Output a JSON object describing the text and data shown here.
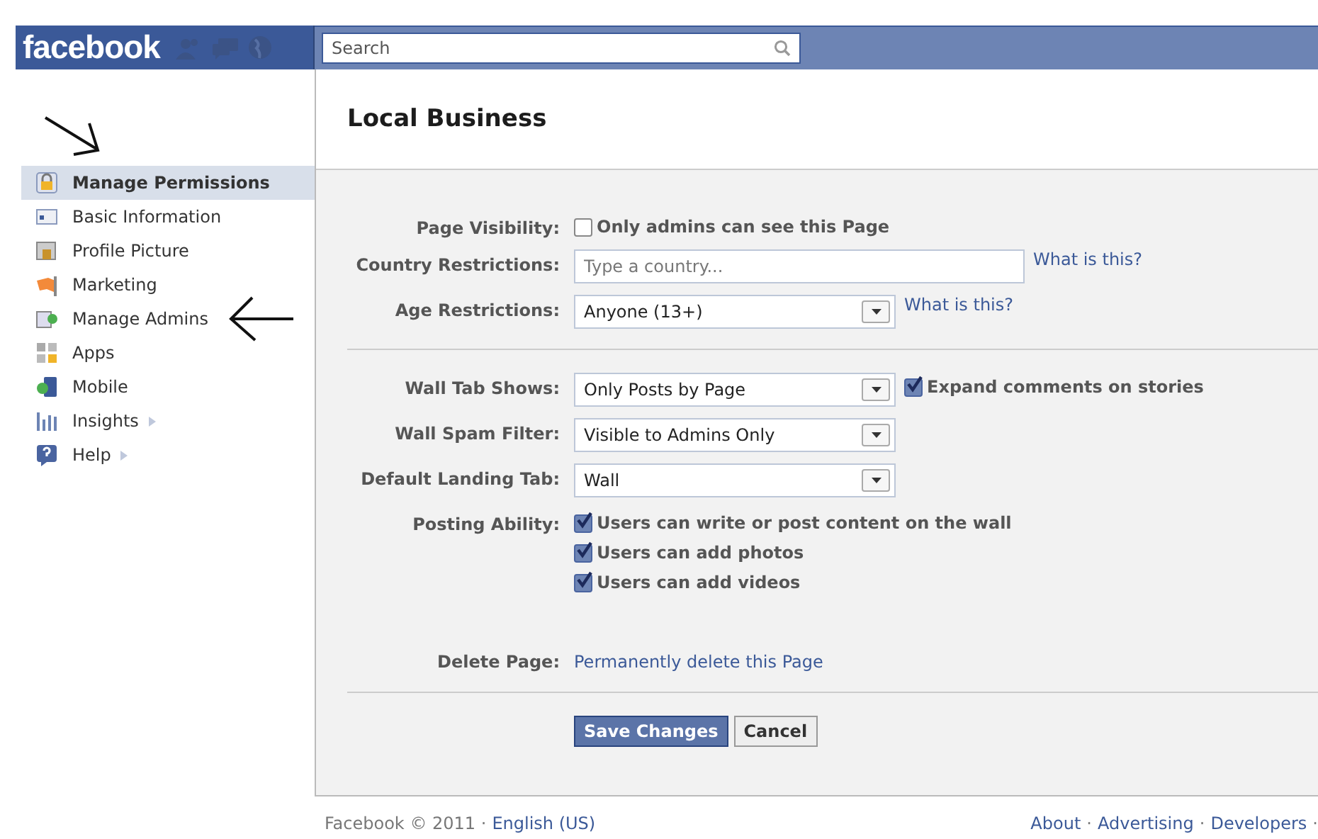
{
  "header": {
    "logo": "facebook",
    "search": {
      "placeholder": "Search"
    }
  },
  "sidebar": {
    "items": [
      {
        "label": "Manage Permissions",
        "selected": true,
        "more": false
      },
      {
        "label": "Basic Information",
        "selected": false,
        "more": false
      },
      {
        "label": "Profile Picture",
        "selected": false,
        "more": false
      },
      {
        "label": "Marketing",
        "selected": false,
        "more": false
      },
      {
        "label": "Manage Admins",
        "selected": false,
        "more": false
      },
      {
        "label": "Apps",
        "selected": false,
        "more": false
      },
      {
        "label": "Mobile",
        "selected": false,
        "more": false
      },
      {
        "label": "Insights",
        "selected": false,
        "more": true
      },
      {
        "label": "Help",
        "selected": false,
        "more": true
      }
    ]
  },
  "page": {
    "title": "Local Business"
  },
  "sections": [
    [
      {
        "kind": "checkbox",
        "label": "Page Visibility:",
        "options": [
          {
            "text": "Only admins can see this Page",
            "checked": false
          }
        ]
      },
      {
        "kind": "text",
        "label": "Country Restrictions:",
        "placeholder": "Type a country...",
        "help": "What is this?"
      },
      {
        "kind": "select",
        "label": "Age Restrictions:",
        "value": "Anyone (13+)",
        "help": "What is this?"
      }
    ],
    [
      {
        "kind": "select",
        "label": "Wall Tab Shows:",
        "value": "Only Posts by Page",
        "extra": {
          "text": "Expand comments on stories",
          "checked": true
        }
      },
      {
        "kind": "select",
        "label": "Wall Spam Filter:",
        "value": "Visible to Admins Only"
      },
      {
        "kind": "select",
        "label": "Default Landing Tab:",
        "value": "Wall"
      },
      {
        "kind": "checkbox",
        "label": "Posting Ability:",
        "options": [
          {
            "text": "Users can write or post content on the wall",
            "checked": true
          },
          {
            "text": "Users can add photos",
            "checked": true
          },
          {
            "text": "Users can add videos",
            "checked": true
          }
        ]
      },
      {
        "kind": "link",
        "label": "Delete Page:",
        "link": "Permanently delete this Page"
      }
    ],
    [
      {
        "kind": "buttons",
        "buttons": [
          {
            "label": "Save Changes",
            "primary": true
          },
          {
            "label": "Cancel",
            "primary": false
          }
        ]
      }
    ]
  ],
  "footer": {
    "copyright": "Facebook © 2011 ·",
    "language": "English (US)",
    "links": [
      "About",
      "Advertising",
      "Developers"
    ],
    "separator": "·"
  }
}
